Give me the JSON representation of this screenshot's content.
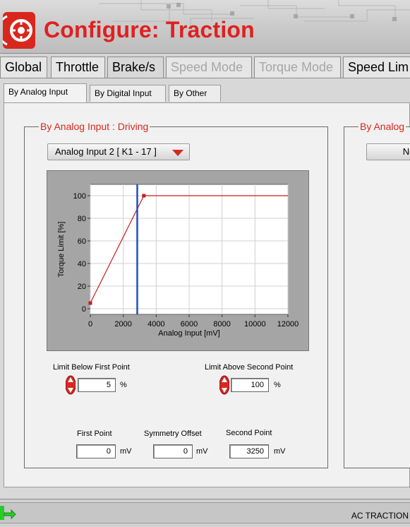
{
  "header": {
    "title": "Configure: Traction"
  },
  "main_tabs": [
    {
      "label": "Global",
      "state": "normal"
    },
    {
      "label": "Throttle",
      "state": "normal"
    },
    {
      "label": "Brake/s",
      "state": "normal"
    },
    {
      "label": "Speed Mode",
      "state": "disabled"
    },
    {
      "label": "Torque Mode",
      "state": "disabled"
    },
    {
      "label": "Speed Lim",
      "state": "normal"
    }
  ],
  "sub_tabs": [
    {
      "label": "By Analog Input",
      "active": true
    },
    {
      "label": "By Digital Input",
      "active": false
    },
    {
      "label": "By Other",
      "active": false
    }
  ],
  "driving": {
    "title": "By Analog Input : Driving",
    "dropdown": "Analog Input 2  [ K1 - 17 ]",
    "limit_below_label": "Limit Below First Point",
    "limit_below_value": "5",
    "limit_below_unit": "%",
    "limit_above_label": "Limit Above Second Point",
    "limit_above_value": "100",
    "limit_above_unit": "%",
    "first_point_label": "First Point",
    "first_point_value": "0",
    "first_point_unit": "mV",
    "symmetry_label": "Symmetry Offset",
    "symmetry_value": "0",
    "symmetry_unit": "mV",
    "second_point_label": "Second Point",
    "second_point_value": "3250",
    "second_point_unit": "mV"
  },
  "second_group": {
    "title": "By Analog",
    "dropdown": "No"
  },
  "status": {
    "text": "AC TRACTION",
    "indicator_color": "#22cc22"
  },
  "colors": {
    "accent_red": "#d8281e",
    "cursor_blue": "#1f4fbf",
    "curve_red": "#c41e1e"
  },
  "chart_data": {
    "type": "line",
    "xlabel": "Analog Input [mV]",
    "ylabel": "Torque Limit [%]",
    "xlim": [
      0,
      12000
    ],
    "ylim": [
      -5,
      110
    ],
    "x_ticks": [
      0,
      2000,
      4000,
      6000,
      8000,
      10000,
      12000
    ],
    "y_ticks": [
      0,
      20,
      40,
      60,
      80,
      100
    ],
    "grid": true,
    "series": [
      {
        "x": [
          0,
          3250,
          12000
        ],
        "y": [
          5,
          100,
          100
        ]
      }
    ],
    "markers": [
      {
        "x": 0,
        "y": 5
      },
      {
        "x": 3250,
        "y": 100
      }
    ],
    "cursor_x": 2850
  }
}
